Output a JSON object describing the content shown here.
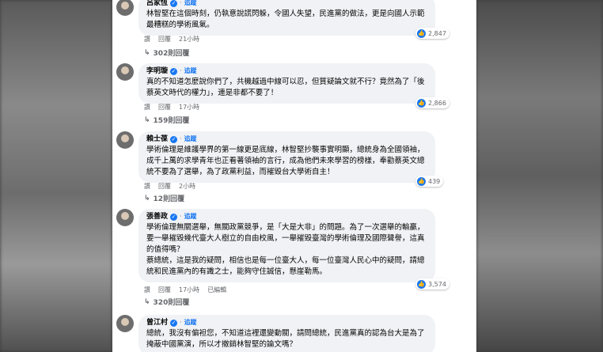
{
  "comments": [
    {
      "name": "呂家恆",
      "follow": "追蹤",
      "text": "林智堅在這個時刻，仍執意說謊閃躲，令國人失望，民進黨的做法，更是向國人示範最糟糕的學術風氣。",
      "actions": [
        "讚",
        "回覆",
        "21小時"
      ],
      "likes": "2,847",
      "replies": "302則回覆"
    },
    {
      "name": "李明璇",
      "follow": "追蹤",
      "text": "真的不知道怎麼說你們了，共機越過中線可以忍，但質疑論文就不行？竟然為了「後蔡英文時代的權力」，連是非都不要了！",
      "actions": [
        "讚",
        "回覆",
        "17小時"
      ],
      "likes": "2,866",
      "replies": "159則回覆"
    },
    {
      "name": "賴士葆",
      "follow": "追蹤",
      "text": "學術倫理是維護學界的第一線更是底線，林智堅抄襲事實明顯，總統身為全國領袖，成千上萬的求學青年也正看著領袖的言行，成為他們未來學習的榜樣，奉勸蔡英文總統不要為了選舉，為了政黨利益，而摧毀台大學術自主！",
      "actions": [
        "讚",
        "回覆",
        "2小時"
      ],
      "likes": "439",
      "replies": "12則回覆"
    },
    {
      "name": "張善政",
      "follow": "追蹤",
      "text": "學術倫理無關選舉，無關政黨競爭，是「大是大非」的問題。為了一次選舉的輸贏，要一舉摧毀幾代臺大人樹立的自由校風，一舉摧毀臺灣的學術倫理及國際聲譽，這真的值得嗎？\n蔡總統，這是我的疑問，相信也是每一位臺大人，每一位臺灣人民心中的疑問，請總統和民進黨內的有識之士，能夠守住誠信，懸崖勒馬。",
      "actions": [
        "讚",
        "回覆",
        "17小時",
        "已編輯"
      ],
      "likes": "3,574",
      "replies": "320則回覆"
    },
    {
      "name": "曾江村",
      "follow": "追蹤",
      "text": "總統，我沒有偏袒您，不知道這裡還變動關，請問總統，民進黨真的認為台大是為了掩蔽中國黨演，所以才撤銷林智堅的論文嗎？",
      "actions": [],
      "likes": "",
      "replies": ""
    }
  ]
}
